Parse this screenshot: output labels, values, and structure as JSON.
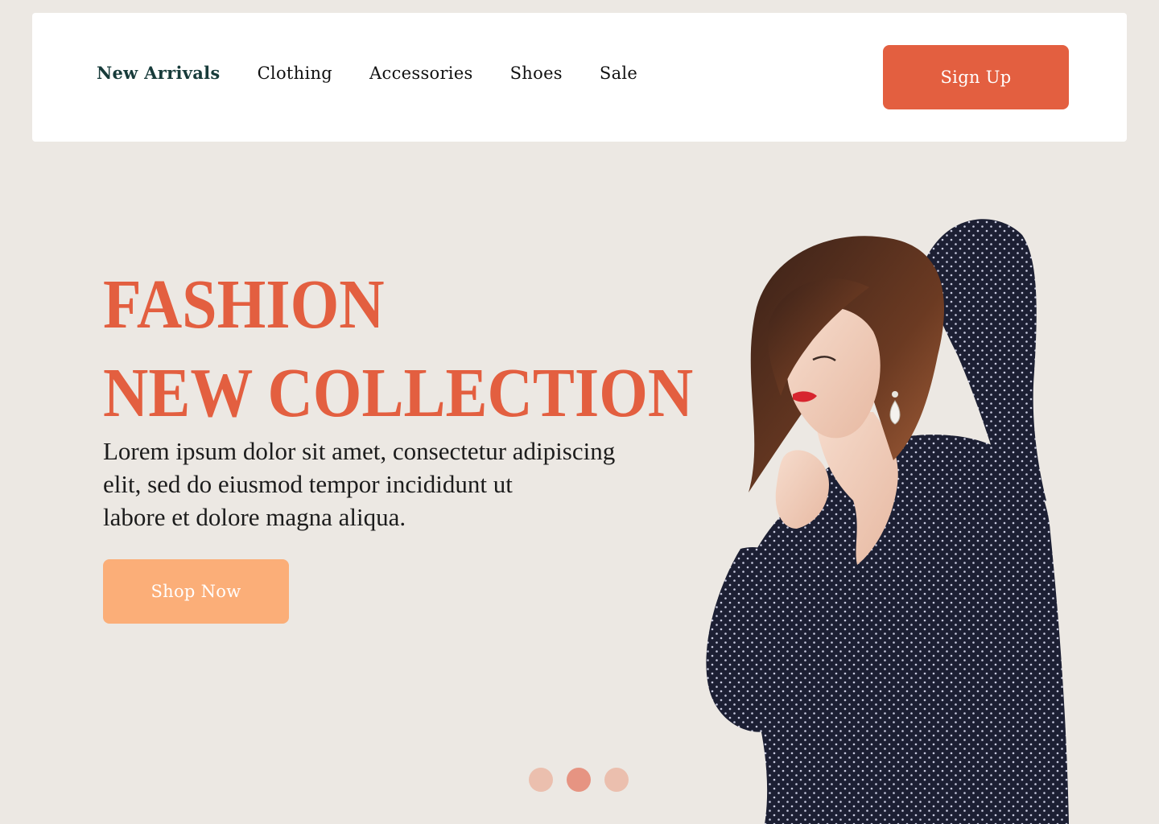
{
  "nav": {
    "links": [
      {
        "label": "New Arrivals",
        "active": true
      },
      {
        "label": "Clothing",
        "active": false
      },
      {
        "label": "Accessories",
        "active": false
      },
      {
        "label": "Shoes",
        "active": false
      },
      {
        "label": "Sale",
        "active": false
      }
    ],
    "signup_label": "Sign Up"
  },
  "hero": {
    "title_line1": "FASHION",
    "title_line2": "NEW COLLECTION",
    "description_lines": [
      "Lorem ipsum dolor sit amet, consectetur adipiscing",
      "elit, sed do eiusmod tempor incididunt ut",
      "labore et dolore magna aliqua."
    ],
    "cta_label": "Shop Now",
    "image_subject": "woman-in-polka-dot-blouse"
  },
  "carousel": {
    "slide_count": 3,
    "active_index": 1
  },
  "colors": {
    "background": "#ece8e3",
    "accent": "#e35f40",
    "cta": "#fbae78",
    "nav_active": "#173b3a",
    "dot": "#ebbfae",
    "dot_active": "#e69482"
  }
}
